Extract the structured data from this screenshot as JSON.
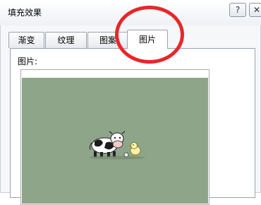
{
  "window": {
    "title": "填充效果",
    "help": "?",
    "close": "✕"
  },
  "tabs": [
    {
      "label": "渐变",
      "active": false
    },
    {
      "label": "纹理",
      "active": false
    },
    {
      "label": "图案",
      "active": false
    },
    {
      "label": "图片",
      "active": true
    }
  ],
  "panel": {
    "picture_label": "图片:"
  },
  "colors": {
    "preview_background": "#8fa58a",
    "highlight": "#e8262b"
  },
  "preview": {
    "content": "cow-and-chick-clipart"
  }
}
